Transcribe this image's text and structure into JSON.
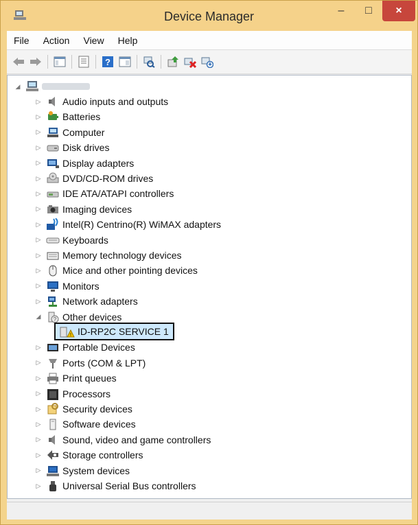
{
  "window": {
    "title": "Device Manager",
    "minimize": "–",
    "maximize": "□",
    "close": "×"
  },
  "menu": [
    "File",
    "Action",
    "View",
    "Help"
  ],
  "toolbar": {
    "icons": [
      "back-icon",
      "forward-icon",
      "show-hide-tree-icon",
      "properties-icon",
      "help-icon",
      "view-icon",
      "scan-hardware-icon",
      "update-driver-icon",
      "uninstall-icon",
      "enable-device-icon"
    ]
  },
  "tree": {
    "root_label": "",
    "categories": [
      {
        "label": "Audio inputs and outputs",
        "icon": "speaker-icon"
      },
      {
        "label": "Batteries",
        "icon": "battery-icon"
      },
      {
        "label": "Computer",
        "icon": "computer-icon"
      },
      {
        "label": "Disk drives",
        "icon": "disk-drive-icon"
      },
      {
        "label": "Display adapters",
        "icon": "display-adapter-icon"
      },
      {
        "label": "DVD/CD-ROM drives",
        "icon": "dvd-drive-icon"
      },
      {
        "label": "IDE ATA/ATAPI controllers",
        "icon": "ide-controller-icon"
      },
      {
        "label": "Imaging devices",
        "icon": "camera-icon"
      },
      {
        "label": "Intel(R) Centrino(R) WiMAX adapters",
        "icon": "wimax-icon"
      },
      {
        "label": "Keyboards",
        "icon": "keyboard-icon"
      },
      {
        "label": "Memory technology devices",
        "icon": "memory-icon"
      },
      {
        "label": "Mice and other pointing devices",
        "icon": "mouse-icon"
      },
      {
        "label": "Monitors",
        "icon": "monitor-icon"
      },
      {
        "label": "Network adapters",
        "icon": "network-icon"
      },
      {
        "label": "Other devices",
        "icon": "unknown-device-icon",
        "expanded": true
      },
      {
        "label": "Portable Devices",
        "icon": "portable-device-icon"
      },
      {
        "label": "Ports (COM & LPT)",
        "icon": "port-icon"
      },
      {
        "label": "Print queues",
        "icon": "printer-icon"
      },
      {
        "label": "Processors",
        "icon": "processor-icon"
      },
      {
        "label": "Security devices",
        "icon": "security-icon"
      },
      {
        "label": "Software devices",
        "icon": "software-device-icon"
      },
      {
        "label": "Sound, video and game controllers",
        "icon": "sound-icon"
      },
      {
        "label": "Storage controllers",
        "icon": "storage-icon"
      },
      {
        "label": "System devices",
        "icon": "system-icon"
      },
      {
        "label": "Universal Serial Bus controllers",
        "icon": "usb-icon"
      }
    ],
    "child_device": {
      "label": "ID-RP2C SERVICE 1",
      "icon": "warning-device-icon"
    }
  }
}
